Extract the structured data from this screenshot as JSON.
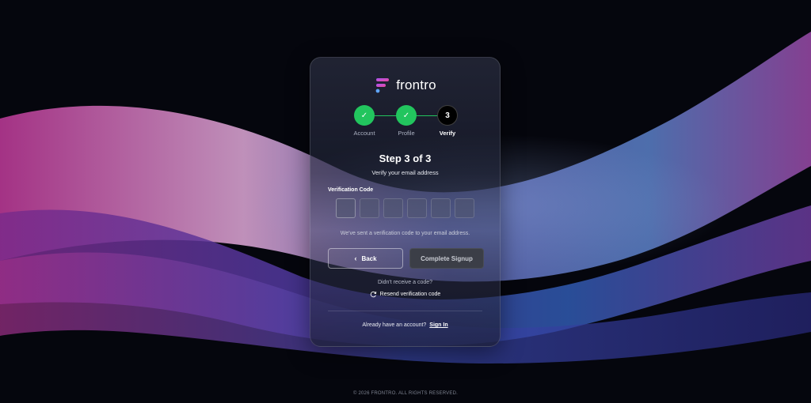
{
  "brand": {
    "name": "frontro"
  },
  "stepper": {
    "steps": [
      {
        "label": "Account",
        "marker": "✓",
        "state": "done"
      },
      {
        "label": "Profile",
        "marker": "✓",
        "state": "done"
      },
      {
        "label": "Verify",
        "marker": "3",
        "state": "active"
      }
    ],
    "accent_color": "#22c55e"
  },
  "form": {
    "title": "Step 3 of 3",
    "subtitle": "Verify your email address",
    "code_label": "Verification Code",
    "code_digits": [
      "",
      "",
      "",
      "",
      "",
      ""
    ],
    "hint": "We've sent a verification code to your email address.",
    "back_label": "Back",
    "complete_label": "Complete Signup",
    "resend_question": "Didn't receive a code?",
    "resend_label": "Resend verification code",
    "signin_prompt": "Already have an account?",
    "signin_link": "Sign In"
  },
  "footer": {
    "text": "© 2026 FRONTRO. ALL RIGHTS RESERVED."
  }
}
